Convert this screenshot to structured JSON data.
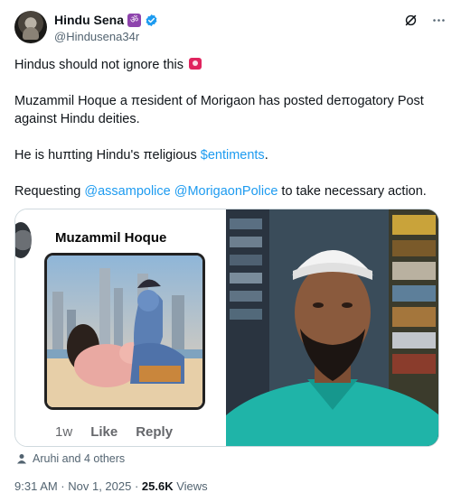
{
  "author": {
    "display_name": "Hindu Sena",
    "handle": "@Hindusena34r",
    "badge_emoji": "ॐ",
    "avatar_icon": "avatar-image"
  },
  "tweet": {
    "line1": "Hindus should not ignore this",
    "line2": "Muzammil Hoque a πesident of Morigaon has posted deπogatory Post against Hindu deities.",
    "line3_prefix": "He is huπting Hindu's πeligious ",
    "line3_link": "$entiments",
    "line3_suffix": ".",
    "line4_prefix": "Requesting ",
    "mention1": "@assampolice",
    "mention2": "@MorigaonPolice",
    "line4_suffix": " to take necessary action."
  },
  "embedded_post": {
    "name": "Muzammil Hoque",
    "time": "1w",
    "like_label": "Like",
    "reply_label": "Reply"
  },
  "likes_text": "Aruhi and 4 others",
  "footer": {
    "timestamp": "9:31 AM · Nov 1, 2025 · ",
    "views_count": "25.6K",
    "views_label": " Views"
  },
  "colors": {
    "link": "#1d9bf0",
    "verified": "#1d9bf0",
    "muted": "#536471",
    "text": "#0f1419"
  }
}
